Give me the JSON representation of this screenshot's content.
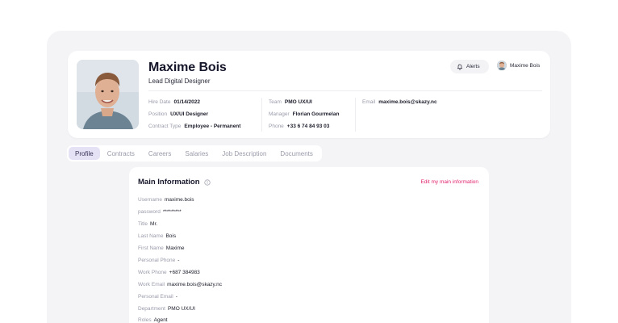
{
  "profile": {
    "name": "Maxime Bois",
    "title": "Lead Digital Designer",
    "alerts_label": "Alerts",
    "user_chip_name": "Maxime Bois",
    "details": {
      "hire_date": {
        "label": "Hire Date",
        "value": "01/14/2022"
      },
      "position": {
        "label": "Position",
        "value": "UX/UI Designer"
      },
      "contract_type": {
        "label": "Contract Type",
        "value": "Employee - Permanent"
      },
      "team": {
        "label": "Team",
        "value": "PMO UX/UI"
      },
      "manager": {
        "label": "Manager",
        "value": "Florian Gourmelan"
      },
      "phone": {
        "label": "Phone",
        "value": "+33 6 74 84 93 03"
      },
      "email": {
        "label": "Email",
        "value": "maxime.bois@skazy.nc"
      }
    }
  },
  "tabs": [
    {
      "label": "Profile",
      "active": true
    },
    {
      "label": "Contracts",
      "active": false
    },
    {
      "label": "Careers",
      "active": false
    },
    {
      "label": "Salaries",
      "active": false
    },
    {
      "label": "Job Description",
      "active": false
    },
    {
      "label": "Documents",
      "active": false
    }
  ],
  "main_info": {
    "title": "Main Information",
    "edit_label": "Edit my main information",
    "fields": [
      {
        "label": "Username",
        "value": "maxime.bois"
      },
      {
        "label": "password",
        "value": "*********"
      },
      {
        "label": "Title",
        "value": "Mr."
      },
      {
        "label": "Last Name",
        "value": "Bois"
      },
      {
        "label": "First Name",
        "value": "Maxime"
      },
      {
        "label": "Personal Phone",
        "value": "-"
      },
      {
        "label": "Work Phone",
        "value": "+687 384983"
      },
      {
        "label": "Work Email",
        "value": "maxime.bois@skazy.nc"
      },
      {
        "label": "Personal Email",
        "value": "-"
      },
      {
        "label": "Department",
        "value": "PMO UX/UI"
      },
      {
        "label": "Roles",
        "value": "Agent"
      }
    ]
  },
  "colors": {
    "accent_link": "#e0246e",
    "active_tab_bg": "#e6e2f6",
    "shell_bg": "#f4f4f7"
  },
  "icons": {
    "alerts": "bell-icon",
    "info": "info-circle-icon"
  }
}
